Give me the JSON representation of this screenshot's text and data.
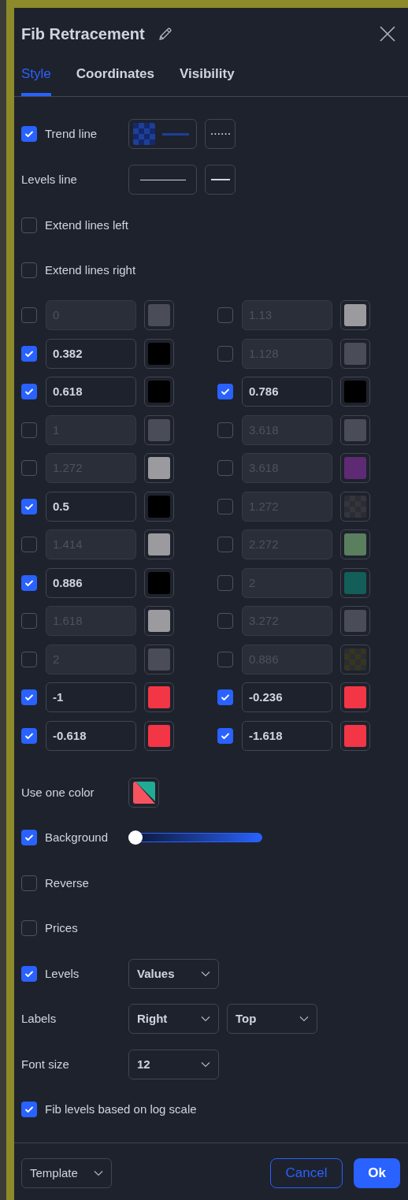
{
  "title": "Fib Retracement",
  "tabs": [
    {
      "label": "Style",
      "selected": true
    },
    {
      "label": "Coordinates",
      "selected": false
    },
    {
      "label": "Visibility",
      "selected": false
    }
  ],
  "trend_line": {
    "label": "Trend line",
    "checked": true,
    "color": "#1e3f99"
  },
  "levels_line": {
    "label": "Levels line"
  },
  "extend_left": {
    "label": "Extend lines left",
    "checked": false
  },
  "extend_right": {
    "label": "Extend lines right",
    "checked": false
  },
  "levels": [
    {
      "value": "0",
      "checked": false,
      "color": "#4a4c57",
      "kind": "solid"
    },
    {
      "value": "1.13",
      "checked": false,
      "color": "#9b9b9f",
      "kind": "solid"
    },
    {
      "value": "0.382",
      "checked": true,
      "color": "#000000",
      "kind": "solid"
    },
    {
      "value": "1.128",
      "checked": false,
      "color": "#4a4c57",
      "kind": "solid"
    },
    {
      "value": "0.618",
      "checked": true,
      "color": "#000000",
      "kind": "solid"
    },
    {
      "value": "0.786",
      "checked": true,
      "color": "#000000",
      "kind": "solid"
    },
    {
      "value": "1",
      "checked": false,
      "color": "#4a4c57",
      "kind": "solid"
    },
    {
      "value": "3.618",
      "checked": false,
      "color": "#4a4c57",
      "kind": "solid"
    },
    {
      "value": "1.272",
      "checked": false,
      "color": "#9b9b9f",
      "kind": "solid"
    },
    {
      "value": "3.618",
      "checked": false,
      "color": "#5e2a73",
      "kind": "solid"
    },
    {
      "value": "0.5",
      "checked": true,
      "color": "#000000",
      "kind": "solid"
    },
    {
      "value": "1.272",
      "checked": false,
      "color": "#34363e",
      "kind": "checkered"
    },
    {
      "value": "1.414",
      "checked": false,
      "color": "#9b9b9f",
      "kind": "solid"
    },
    {
      "value": "2.272",
      "checked": false,
      "color": "#5a7f5e",
      "kind": "solid"
    },
    {
      "value": "0.886",
      "checked": true,
      "color": "#000000",
      "kind": "solid"
    },
    {
      "value": "2",
      "checked": false,
      "color": "#135e58",
      "kind": "solid"
    },
    {
      "value": "1.618",
      "checked": false,
      "color": "#9b9b9f",
      "kind": "solid"
    },
    {
      "value": "3.272",
      "checked": false,
      "color": "#4a4c57",
      "kind": "solid"
    },
    {
      "value": "2",
      "checked": false,
      "color": "#4a4c57",
      "kind": "solid"
    },
    {
      "value": "0.886",
      "checked": false,
      "color": "#36361f",
      "kind": "checkered"
    },
    {
      "value": "-1",
      "checked": true,
      "color": "#f23645",
      "kind": "solid"
    },
    {
      "value": "-0.236",
      "checked": true,
      "color": "#f23645",
      "kind": "solid"
    },
    {
      "value": "-0.618",
      "checked": true,
      "color": "#f23645",
      "kind": "solid"
    },
    {
      "value": "-1.618",
      "checked": true,
      "color": "#f23645",
      "kind": "solid"
    }
  ],
  "use_one_color": {
    "label": "Use one color"
  },
  "background": {
    "label": "Background",
    "checked": true,
    "level": 0
  },
  "reverse": {
    "label": "Reverse",
    "checked": false
  },
  "prices": {
    "label": "Prices",
    "checked": false
  },
  "levels_labels": {
    "label": "Levels",
    "checked": true,
    "value": "Values"
  },
  "labels": {
    "label": "Labels",
    "horizontal": "Right",
    "vertical": "Top"
  },
  "font_size": {
    "label": "Font size",
    "value": "12"
  },
  "log_scale": {
    "label": "Fib levels based on log scale",
    "checked": true
  },
  "footer": {
    "template": "Template",
    "cancel": "Cancel",
    "ok": "Ok"
  }
}
